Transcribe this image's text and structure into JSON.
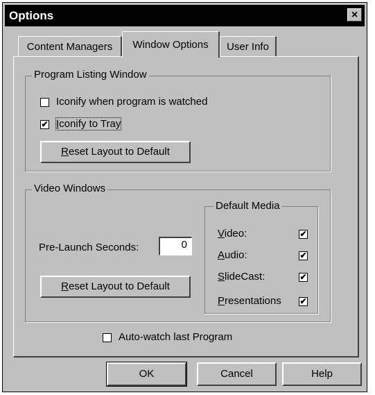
{
  "window": {
    "title": "Options",
    "close": "×"
  },
  "tabs": [
    {
      "label": "Content Managers"
    },
    {
      "label": "Window Options"
    },
    {
      "label": "User Info"
    }
  ],
  "program_listing": {
    "title": "Program Listing Window",
    "iconify_watched": {
      "label": "Iconify when program is watched",
      "checked": false
    },
    "iconify_tray": {
      "label_mnemonic": "I",
      "label_rest": "conify to Tray",
      "checked": true
    },
    "reset": {
      "mnemonic": "R",
      "rest": "eset Layout to Default"
    }
  },
  "video_windows": {
    "title": "Video Windows",
    "prelaunch_label": "Pre-Launch Seconds:",
    "prelaunch_value": "0",
    "reset": {
      "mnemonic": "R",
      "rest": "eset Layout to Default"
    },
    "default_media": {
      "title": "Default Media",
      "items": [
        {
          "mnemonic": "V",
          "rest": "ideo:",
          "checked": true
        },
        {
          "mnemonic": "A",
          "rest": "udio:",
          "checked": true
        },
        {
          "mnemonic": "S",
          "rest": "lideCast:",
          "checked": true
        },
        {
          "mnemonic": "P",
          "rest": "resentations",
          "checked": true
        }
      ]
    }
  },
  "auto_watch": {
    "label": "Auto-watch last Program",
    "checked": false
  },
  "buttons": {
    "ok": "OK",
    "cancel": "Cancel",
    "help": "Help"
  },
  "check_mark": "✔"
}
